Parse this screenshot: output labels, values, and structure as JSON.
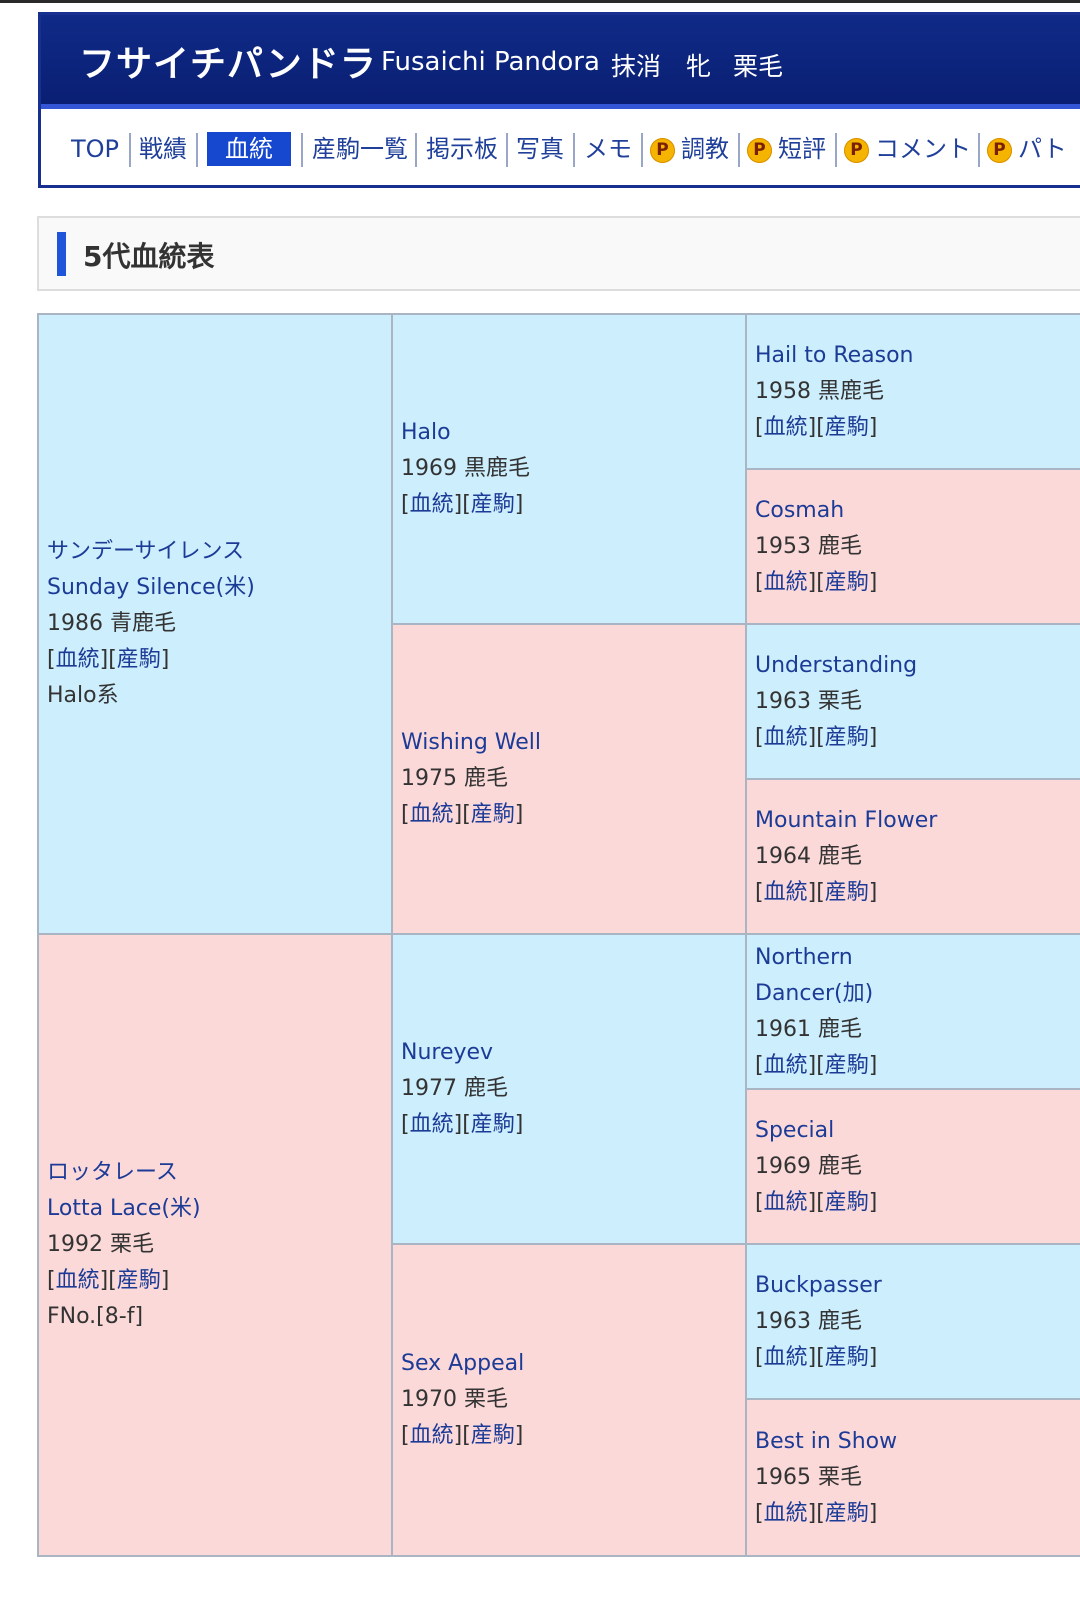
{
  "header": {
    "name_jp": "フサイチパンドラ",
    "name_en": "Fusaichi Pandora",
    "status": "抹消",
    "sex": "牝",
    "color": "栗毛"
  },
  "nav": {
    "top": "TOP",
    "results": "戦績",
    "pedigree": "血統",
    "offspring": "産駒一覧",
    "board": "掲示板",
    "photos": "写真",
    "memo": "メモ",
    "p_badge": "P",
    "training": "調教",
    "review": "短評",
    "comment": "コメント",
    "partial": "パト"
  },
  "section": {
    "title": "5代血統表"
  },
  "link_labels": {
    "pedigree": "血統",
    "offspring": "産駒",
    "open": "[",
    "mid": "][",
    "close": "]"
  },
  "pedigree": {
    "sire": {
      "name_jp": "サンデーサイレンス",
      "name_en": "Sunday Silence(米)",
      "info": "1986 青鹿毛",
      "extra": "Halo系"
    },
    "dam": {
      "name_jp": "ロッタレース",
      "name_en": "Lotta Lace(米)",
      "info": "1992 栗毛",
      "extra": "FNo.[8-f]"
    },
    "gen2": [
      {
        "name": "Halo",
        "info": "1969 黒鹿毛"
      },
      {
        "name": "Wishing Well",
        "info": "1975 鹿毛"
      },
      {
        "name": "Nureyev",
        "info": "1977 鹿毛"
      },
      {
        "name": "Sex Appeal",
        "info": "1970 栗毛"
      }
    ],
    "gen3": [
      {
        "name": "Hail to Reason",
        "info": "1958 黒鹿毛"
      },
      {
        "name": "Cosmah",
        "info": "1953 鹿毛"
      },
      {
        "name": "Understanding",
        "info": "1963 栗毛"
      },
      {
        "name": "Mountain Flower",
        "info": "1964 鹿毛"
      },
      {
        "name": "Northern Dancer(加)",
        "info": "1961 鹿毛"
      },
      {
        "name": "Special",
        "info": "1969 鹿毛"
      },
      {
        "name": "Buckpasser",
        "info": "1963 鹿毛"
      },
      {
        "name": "Best in Show",
        "info": "1965 栗毛"
      }
    ]
  },
  "colors": {
    "header_bg": "#0f2a87",
    "active_tab": "#1548cf",
    "male_cell": "#cdeefc",
    "female_cell": "#fcd9d9",
    "link": "#1c3b96"
  }
}
